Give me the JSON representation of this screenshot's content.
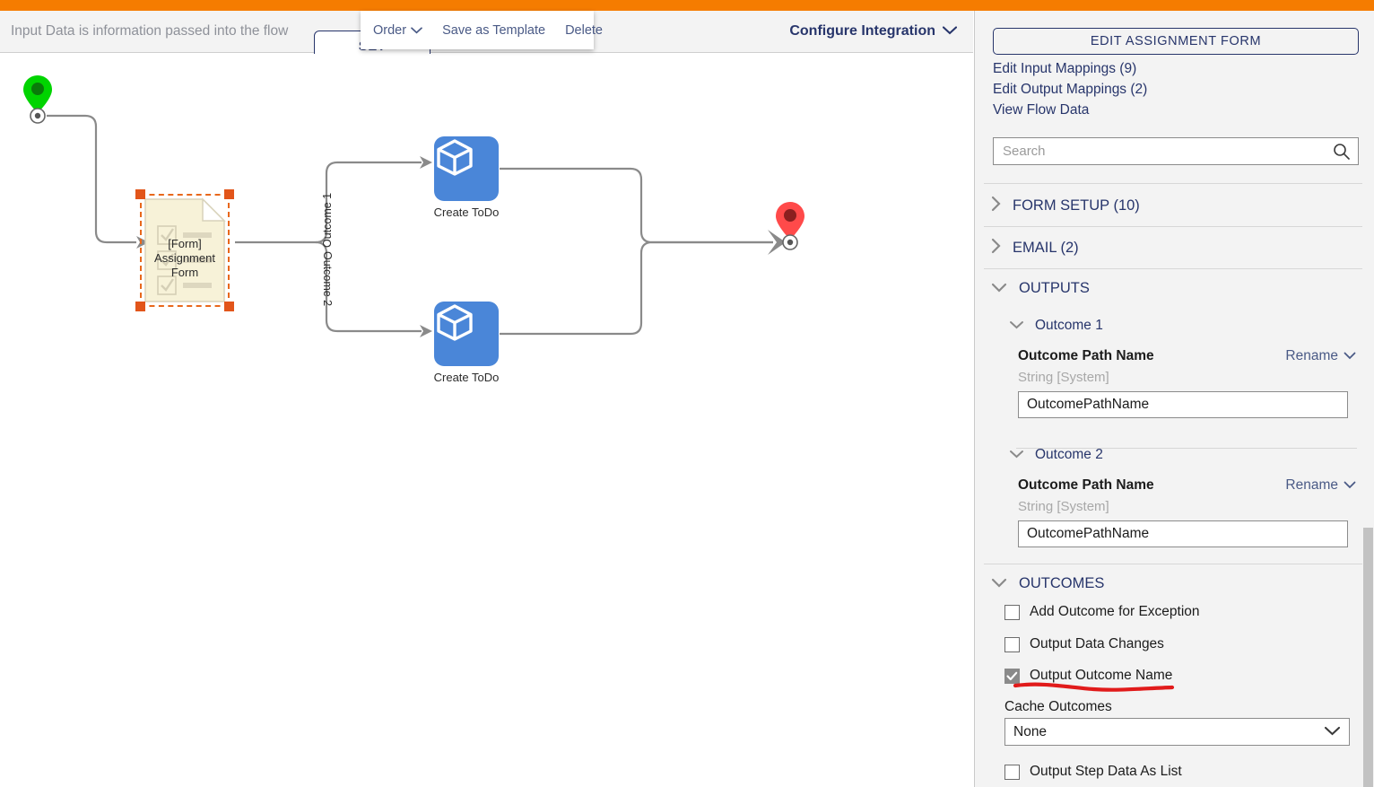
{
  "theme": {
    "accent_orange": "#f57c00",
    "brand_navy": "#27356b",
    "node_blue": "#4a86d8",
    "selection_orange": "#e2551a",
    "annotation_red": "#e11b1b"
  },
  "header": {
    "hint_text": "Input Data is information passed into the flow",
    "set_button_label": "SET",
    "configure_label": "Configure Integration",
    "configure_chevron": "chevron-down-icon"
  },
  "context_menu": {
    "order_label": "Order",
    "order_chevron": "chevron-down-icon",
    "save_as_template_label": "Save as Template",
    "delete_label": "Delete"
  },
  "canvas": {
    "start_node": {
      "name": "start-pin",
      "color": "#00d400"
    },
    "end_node": {
      "name": "end-pin",
      "color": "#ff4a4a"
    },
    "form_node": {
      "label_line1": "[Form]",
      "label_line2": "Assignment",
      "label_line3": "Form",
      "selected": true
    },
    "edge_labels": [
      "Outcome 1",
      "Outcome 2"
    ],
    "todo_nodes": [
      {
        "label": "Create ToDo"
      },
      {
        "label": "Create ToDo"
      }
    ]
  },
  "panel": {
    "edit_form_button": "EDIT ASSIGNMENT FORM",
    "links": [
      "Edit Input Mappings (9)",
      "Edit Output Mappings (2)",
      "View Flow Data"
    ],
    "search": {
      "placeholder": "Search",
      "value": "",
      "icon": "search-icon"
    },
    "sections": [
      {
        "title": "FORM SETUP (10)",
        "expanded": false,
        "chevron": "chevron-right-icon"
      },
      {
        "title": "EMAIL (2)",
        "expanded": false,
        "chevron": "chevron-right-icon"
      },
      {
        "title": "OUTPUTS",
        "expanded": true,
        "chevron": "chevron-down-icon"
      }
    ],
    "outputs": [
      {
        "name": "Outcome 1",
        "chevron": "chevron-down-icon",
        "field_label": "Outcome Path Name",
        "rename_label": "Rename",
        "rename_chevron": "chevron-down-icon",
        "type_text": "String [System]",
        "value": "OutcomePathName"
      },
      {
        "name": "Outcome 2",
        "chevron": "chevron-down-icon",
        "field_label": "Outcome Path Name",
        "rename_label": "Rename",
        "rename_chevron": "chevron-down-icon",
        "type_text": "String [System]",
        "value": "OutcomePathName"
      }
    ],
    "outcomes_section": {
      "title": "OUTCOMES",
      "chevron": "chevron-down-icon",
      "checkboxes": [
        {
          "label": "Add Outcome for Exception",
          "checked": false
        },
        {
          "label": "Output Data Changes",
          "checked": false
        },
        {
          "label": "Output Outcome Name",
          "checked": true,
          "annotated": true
        }
      ],
      "cache_label": "Cache Outcomes",
      "cache_value": "None",
      "cache_chevron": "chevron-down-icon",
      "trailing_checkbox": {
        "label": "Output Step Data As List",
        "checked": false
      }
    }
  }
}
